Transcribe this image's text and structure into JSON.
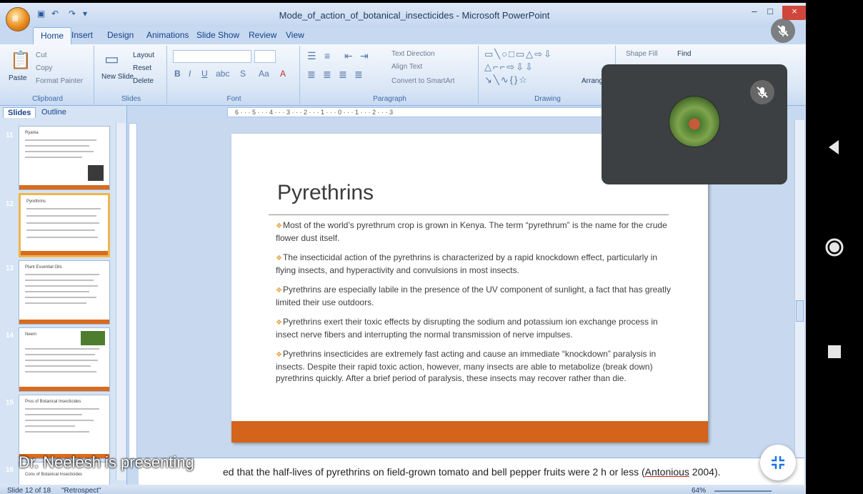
{
  "window": {
    "title": "Mode_of_action_of_botanical_insecticides - Microsoft PowerPoint",
    "minimize": "–",
    "maximize": "□",
    "close": "×"
  },
  "ribbon_tabs": [
    "Home",
    "Insert",
    "Design",
    "Animations",
    "Slide Show",
    "Review",
    "View"
  ],
  "ribbon": {
    "clipboard": {
      "label": "Clipboard",
      "paste": "Paste",
      "cut": "Cut",
      "copy": "Copy",
      "format_painter": "Format Painter"
    },
    "slides": {
      "label": "Slides",
      "new_slide": "New Slide",
      "layout": "Layout",
      "reset": "Reset",
      "delete": "Delete"
    },
    "font": {
      "label": "Font"
    },
    "paragraph": {
      "label": "Paragraph",
      "text_direction": "Text Direction",
      "align_text": "Align Text",
      "convert_smartart": "Convert to SmartArt"
    },
    "drawing": {
      "label": "Drawing",
      "arrange": "Arrange",
      "shape_fill": "Shape Fill"
    },
    "editing": {
      "find": "Find"
    }
  },
  "left_pane": {
    "tabs": [
      "Slides",
      "Outline"
    ],
    "thumbnails": [
      {
        "number": "11",
        "title": "Ryania"
      },
      {
        "number": "12",
        "title": "Pyrethrins"
      },
      {
        "number": "13",
        "title": "Plant Essential Oils"
      },
      {
        "number": "14",
        "title": "Neem"
      },
      {
        "number": "15",
        "title": "Pros of Botanical Insecticides"
      },
      {
        "number": "16",
        "title": "Cons of Botanical Insecticides"
      }
    ]
  },
  "ruler": "6 · · · 5 · · · 4 · · · 3 · · · 2 · · · 1 · · · 0 · · · 1 · · · 2 · · · 3",
  "slide": {
    "title": "Pyrethrins",
    "bullets": [
      "Most of the world’s pyrethrum crop is grown in Kenya. The term “pyrethrum” is the name for the crude flower dust itself.",
      "The insecticidal action of the pyrethrins is characterized by a rapid knockdown effect, particularly in flying insects, and hyperactivity and convulsions in most insects.",
      "Pyrethrins are especially labile in the presence of the UV component of sunlight, a fact that has greatly limited their use outdoors.",
      "Pyrethrins exert their toxic effects by disrupting the sodium and potassium ion exchange process in insect nerve fibers and interrupting the normal transmission of nerve impulses.",
      "Pyrethrins insecticides are extremely fast acting and cause an immediate “knockdown” paralysis in insects. Despite their rapid toxic action, however, many insects are able to metabolize (break down) pyrethrins quickly. After a brief period of paralysis, these insects may recover rather than die."
    ],
    "bullet_mark": "❖"
  },
  "notes": {
    "text_pre": "ed that the half-lives of pyrethrins on field-grown tomato and bell pepper fruits were 2 h or less (",
    "text_link": "Antonious",
    "text_post": " 2004)."
  },
  "status": {
    "slide": "Slide 12 of 18",
    "theme": "\"Retrospect\"",
    "zoom": "64%"
  },
  "meeting": {
    "presenter_label": "Dr. Neelesh is presenting"
  },
  "colors": {
    "accent_orange": "#d4631c",
    "bullet_gold": "#e4a33a",
    "tile_bg": "#3c4043"
  }
}
